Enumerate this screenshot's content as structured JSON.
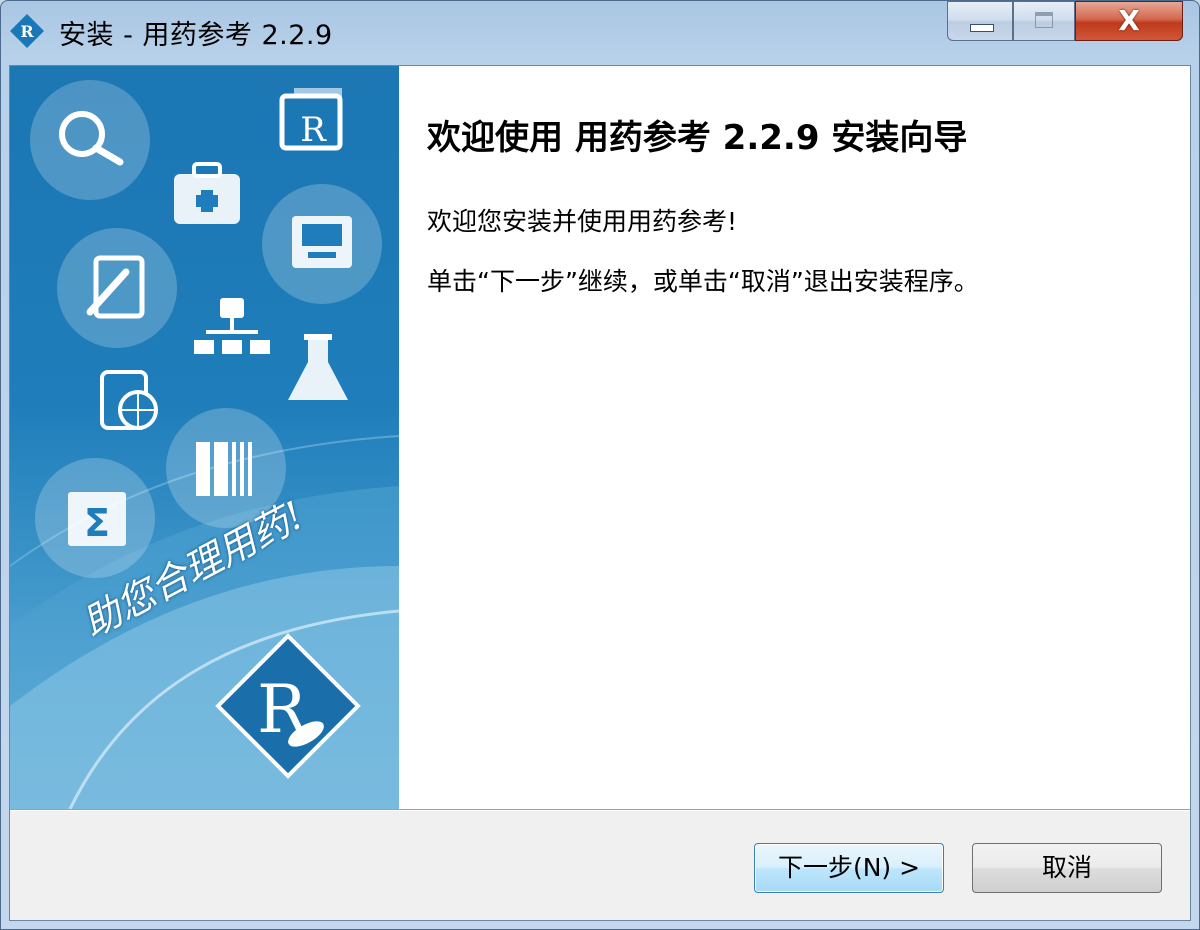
{
  "window": {
    "title": "安装 - 用药参考 2.2.9",
    "icon": "rx-logo-icon"
  },
  "caption_buttons": {
    "minimize": "minimize-icon",
    "maximize": "maximize-icon",
    "close_glyph": "X"
  },
  "banner": {
    "slogan": "助您合理用药!",
    "icons": [
      "search-icon",
      "rx-prescription-icon",
      "medical-kit-icon",
      "document-tray-icon",
      "hand-writing-icon",
      "network-tree-icon",
      "flask-icon",
      "globe-document-icon",
      "book-shelf-icon",
      "sigma-icon"
    ],
    "logo": "rx-logo"
  },
  "content": {
    "heading": "欢迎使用 用药参考 2.2.9 安装向导",
    "paragraph1": "欢迎您安装并使用用药参考!",
    "paragraph2": "单击“下一步”继续，或单击“取消”退出安装程序。"
  },
  "buttons": {
    "next": "下一步(N) >",
    "cancel": "取消"
  },
  "colors": {
    "banner_blue": "#1e7dba",
    "close_red": "#c0391b",
    "focus_border": "#3c7fb1"
  }
}
